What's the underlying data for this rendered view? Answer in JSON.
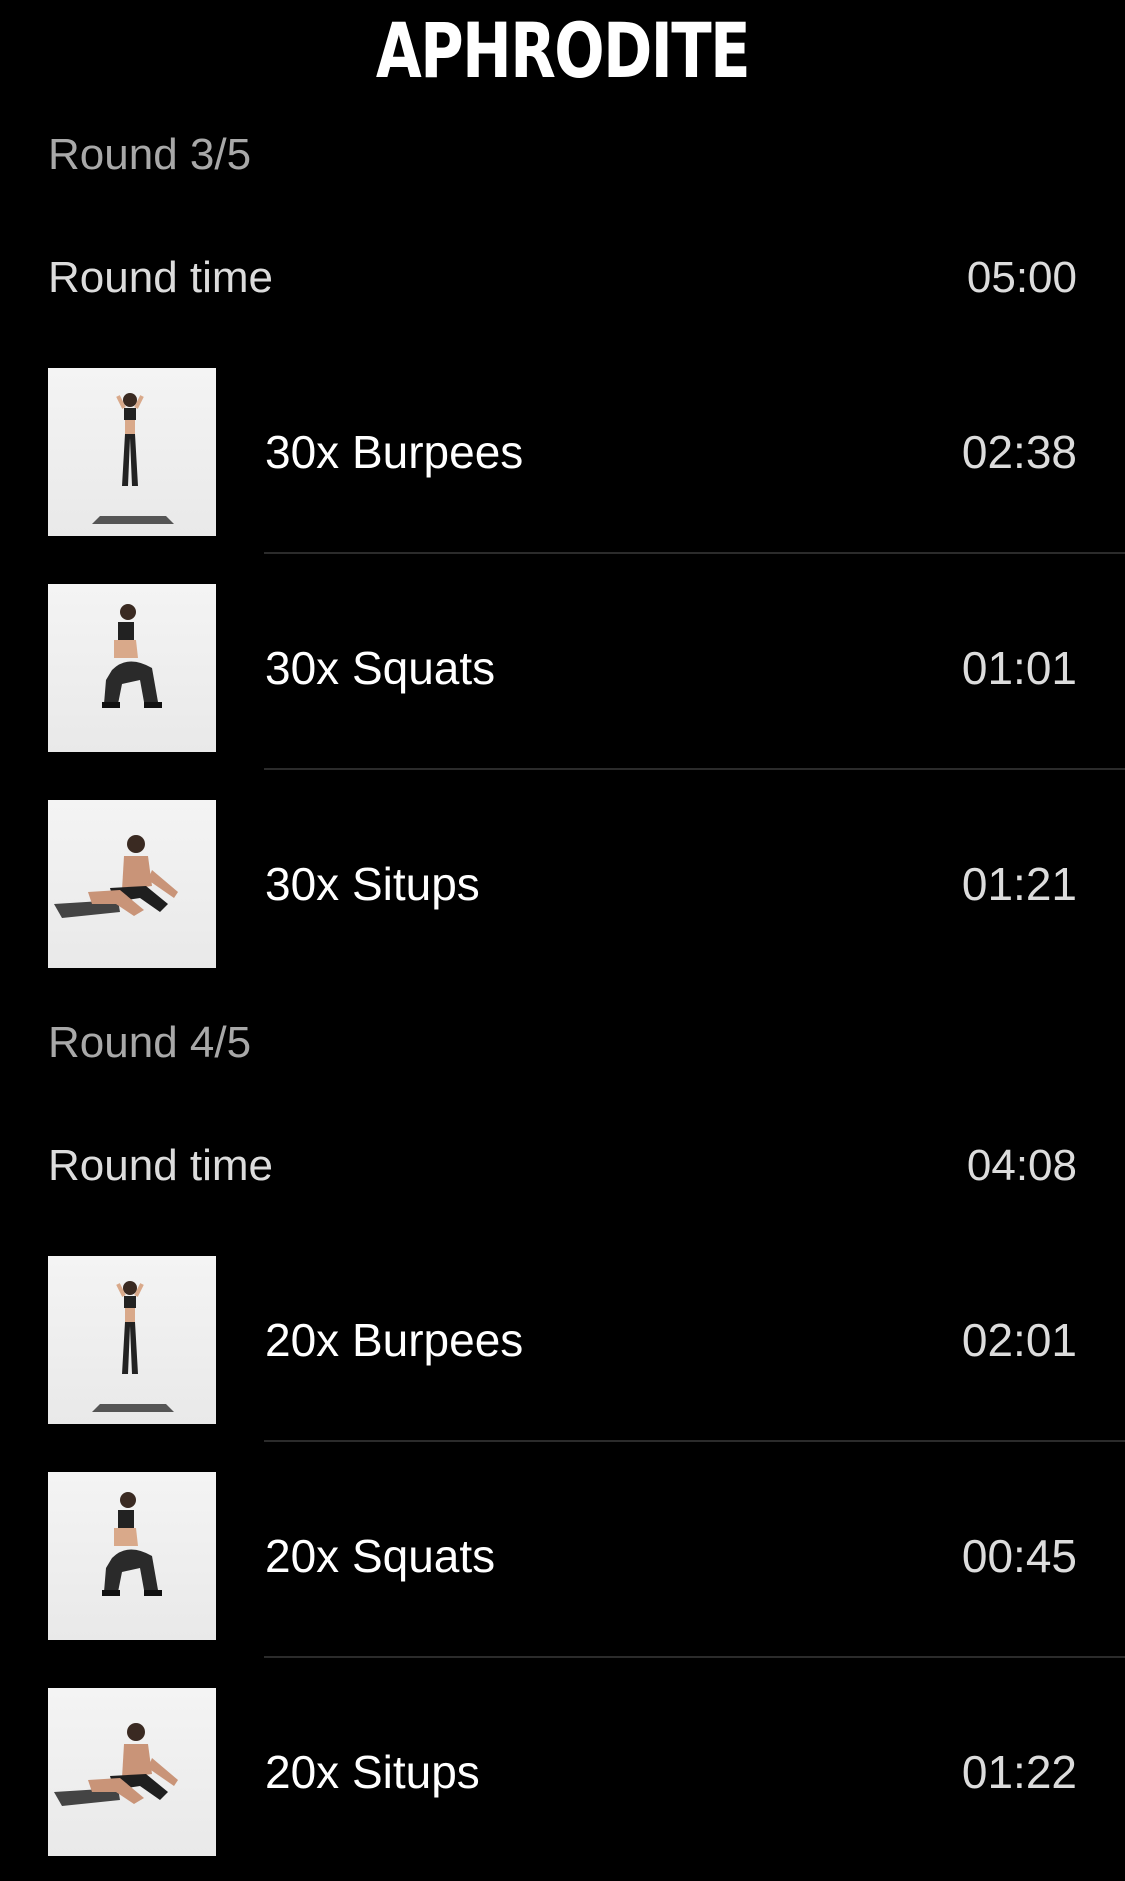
{
  "header": {
    "title": "APHRODITE"
  },
  "rounds": [
    {
      "label": "Round 3/5",
      "round_time_label": "Round time",
      "round_time_value": "05:00",
      "exercises": [
        {
          "name": "30x Burpees",
          "time": "02:38",
          "image": "burpee-pose"
        },
        {
          "name": "30x Squats",
          "time": "01:01",
          "image": "squat-pose"
        },
        {
          "name": "30x Situps",
          "time": "01:21",
          "image": "situp-pose"
        }
      ]
    },
    {
      "label": "Round 4/5",
      "round_time_label": "Round time",
      "round_time_value": "04:08",
      "exercises": [
        {
          "name": "20x Burpees",
          "time": "02:01",
          "image": "burpee-pose"
        },
        {
          "name": "20x Squats",
          "time": "00:45",
          "image": "squat-pose"
        },
        {
          "name": "20x Situps",
          "time": "01:22",
          "image": "situp-pose"
        }
      ]
    }
  ]
}
